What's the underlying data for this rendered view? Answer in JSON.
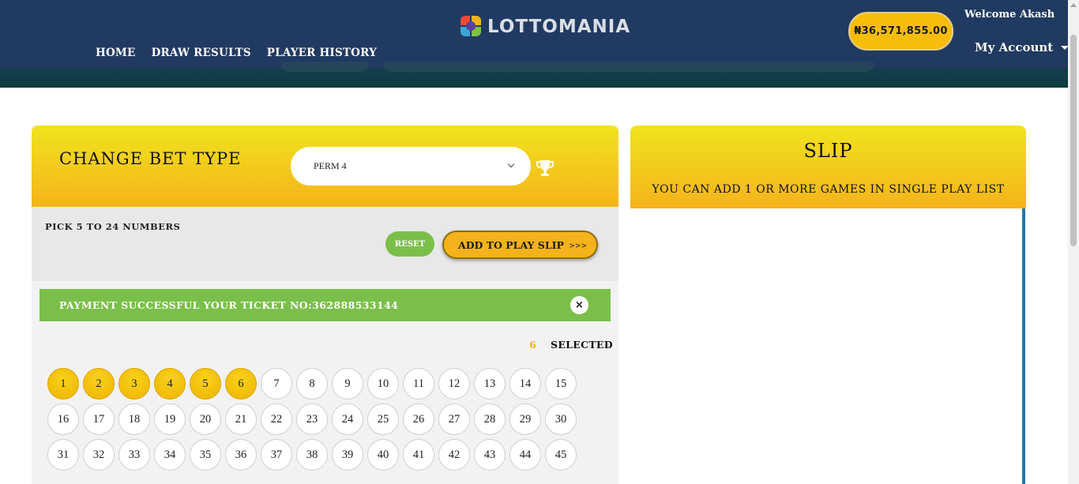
{
  "header": {
    "logo_text": "LOTTOMANIA",
    "nav": [
      "HOME",
      "DRAW RESULTS",
      "PLAYER HISTORY"
    ],
    "balance": "₦36,571,855.00",
    "welcome": "Welcome Akash",
    "account": "My Account",
    "colors": {
      "bar": "#213a61",
      "accent": "#f5b31b"
    }
  },
  "bet": {
    "title": "CHANGE BET TYPE",
    "selected_type": "PERM 4",
    "pick_label": "PICK 5 TO 24 NUMBERS",
    "reset_label": "RESET",
    "add_label": "ADD TO PLAY SLIP",
    "add_arrows": ">>>",
    "notice": "PAYMENT SUCCESSFUL YOUR TICKET NO:362888533144",
    "close_glyph": "×",
    "selected_count": "6",
    "selected_label": "SELECTED",
    "numbers": [
      "1",
      "2",
      "3",
      "4",
      "5",
      "6",
      "7",
      "8",
      "9",
      "10",
      "11",
      "12",
      "13",
      "14",
      "15",
      "16",
      "17",
      "18",
      "19",
      "20",
      "21",
      "22",
      "23",
      "24",
      "25",
      "26",
      "27",
      "28",
      "29",
      "30",
      "31",
      "32",
      "33",
      "34",
      "35",
      "36",
      "37",
      "38",
      "39",
      "40",
      "41",
      "42",
      "43",
      "44",
      "45"
    ],
    "selected_numbers": [
      "1",
      "2",
      "3",
      "4",
      "5",
      "6"
    ]
  },
  "slip": {
    "title": "SLIP",
    "subtitle": "YOU CAN ADD 1 OR MORE GAMES IN SINGLE PLAY LIST"
  }
}
